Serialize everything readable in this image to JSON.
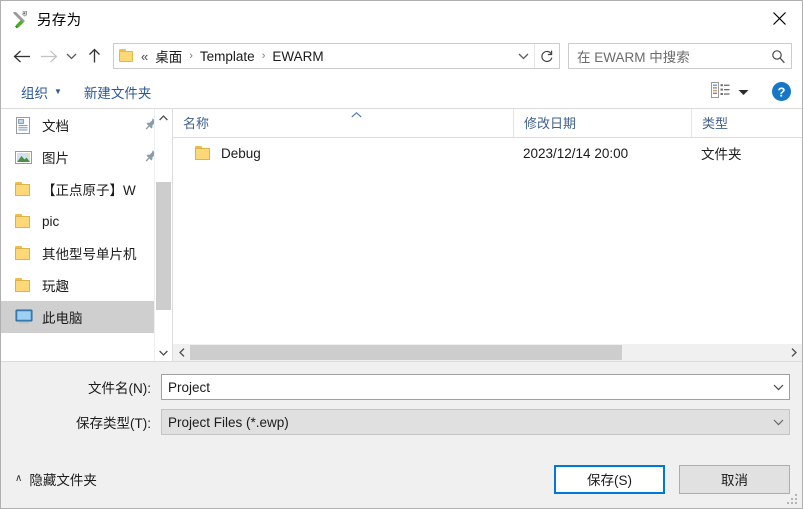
{
  "window": {
    "title": "另存为",
    "app_icon": "iar-workbench-icon",
    "close_label": "✕"
  },
  "nav": {
    "back": "back-arrow",
    "forward": "forward-arrow",
    "recent": "chevron-down",
    "up": "up-arrow",
    "breadcrumb": {
      "overflow": "«",
      "separator": "›",
      "items": [
        "桌面",
        "Template",
        "EWARM"
      ]
    },
    "dropdown": "chevron-down",
    "refresh": "refresh-icon"
  },
  "search": {
    "placeholder": "在 EWARM 中搜索",
    "icon": "search-icon"
  },
  "toolbar": {
    "organize_label": "组织",
    "organize_caret": "▼",
    "new_folder_label": "新建文件夹",
    "view_icon": "list-view-icon",
    "view_caret": "▼",
    "help_label": "?"
  },
  "sidebar": {
    "items": [
      {
        "label": "文档",
        "icon": "document-icon",
        "pinned": true,
        "selected": false
      },
      {
        "label": "图片",
        "icon": "pictures-icon",
        "pinned": true,
        "selected": false
      },
      {
        "label": "【正点原子】W",
        "icon": "folder-icon",
        "pinned": false,
        "selected": false
      },
      {
        "label": "pic",
        "icon": "folder-icon",
        "pinned": false,
        "selected": false
      },
      {
        "label": "其他型号单片机",
        "icon": "folder-icon",
        "pinned": false,
        "selected": false
      },
      {
        "label": "玩趣",
        "icon": "folder-icon",
        "pinned": false,
        "selected": false
      },
      {
        "label": "此电脑",
        "icon": "computer-icon",
        "pinned": false,
        "selected": true
      }
    ]
  },
  "filelist": {
    "columns": [
      "名称",
      "修改日期",
      "类型"
    ],
    "sort_indicator": "^",
    "rows": [
      {
        "name": "Debug",
        "date": "2023/12/14 20:00",
        "type": "文件夹",
        "icon": "folder-icon"
      }
    ]
  },
  "form": {
    "filename_label": "文件名(N):",
    "filename_value": "Project",
    "filetype_label": "保存类型(T):",
    "filetype_value": "Project Files (*.ewp)",
    "dropdown_icon": "chevron-down"
  },
  "footer": {
    "hide_folders_caret": "∧",
    "hide_folders_label": "隐藏文件夹",
    "save_label": "保存(S)",
    "cancel_label": "取消"
  },
  "colors": {
    "accent": "#0078d7",
    "command_text": "#2b579a",
    "column_header": "#41618f",
    "folder_yellow": "#fcd878",
    "selection_gray": "#cfcfcf",
    "panel_gray": "#f0f0f0"
  }
}
